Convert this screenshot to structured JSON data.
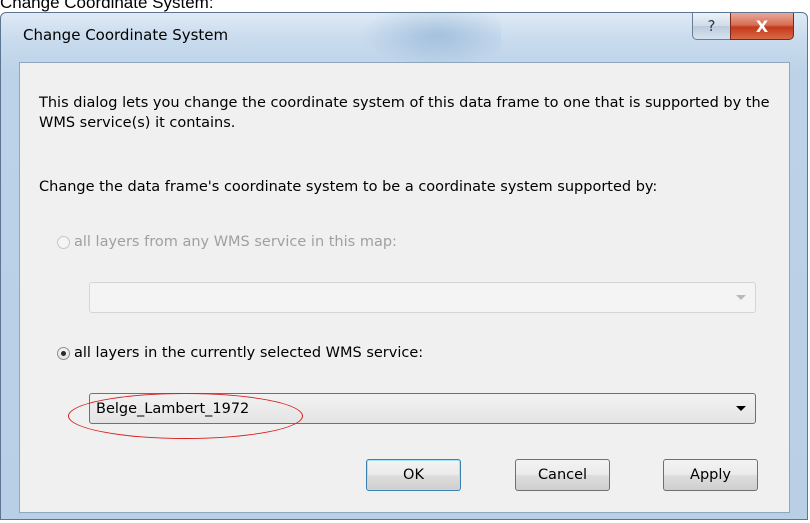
{
  "caption": "Change Coordinate System:",
  "window": {
    "title": "Change Coordinate System",
    "help_glyph": "?",
    "close_glyph": "X"
  },
  "dialog": {
    "description": "This dialog lets you change the coordinate system of this data frame to one that is supported by the WMS service(s) it contains.",
    "change_label": "Change the data frame's coordinate system to be a coordinate system supported by:",
    "option_all_services": {
      "label": "all layers from any WMS service in this map:",
      "checked": false,
      "enabled": false
    },
    "combo_all_services": {
      "value": "",
      "enabled": false
    },
    "option_selected_service": {
      "label": "all layers in the currently selected WMS service:",
      "checked": true,
      "enabled": true
    },
    "combo_selected_service": {
      "value": "Belge_Lambert_1972",
      "enabled": true
    },
    "buttons": {
      "ok": "OK",
      "cancel": "Cancel",
      "apply": "Apply"
    }
  },
  "colors": {
    "highlight_ellipse": "#d81e1e",
    "close_button": "#c4391b"
  },
  "icons": {
    "help": "question-mark-icon",
    "close": "close-icon",
    "dropdown": "chevron-down-icon"
  }
}
